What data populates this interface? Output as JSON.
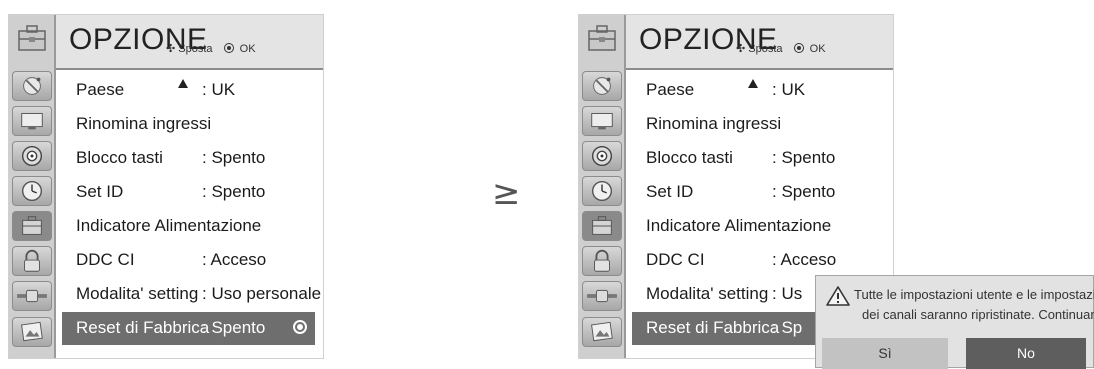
{
  "title": "OPZIONE",
  "nav_hint": "Sposta",
  "ok_hint": "OK",
  "separator": "≥",
  "items": [
    {
      "label": "Paese",
      "value": ": UK"
    },
    {
      "label": "Rinomina ingressi",
      "value": ""
    },
    {
      "label": "Blocco tasti",
      "value": ": Spento"
    },
    {
      "label": "Set ID",
      "value": ": Spento"
    },
    {
      "label": "Indicatore Alimentazione",
      "value": ""
    },
    {
      "label": "DDC CI",
      "value": ": Acceso"
    },
    {
      "label": "Modalita' setting",
      "value": ": Uso personale"
    },
    {
      "label": "Reset di Fabbrica",
      "value": ": Spento"
    }
  ],
  "right_items": {
    "modalita_value": ": Us",
    "reset_value": ": Sp"
  },
  "sidebar_icons": [
    "toolbox-icon",
    "satellite-icon",
    "monitor-icon",
    "speaker-icon",
    "clock-icon",
    "toolbox-icon",
    "lock-icon",
    "plug-icon",
    "photo-icon"
  ],
  "dialog": {
    "message_line1": "Tutte le impostazioni utente e le impostazioni",
    "message_line2": "dei canali saranno ripristinate. Continuare?",
    "yes": "Sì",
    "no": "No"
  }
}
